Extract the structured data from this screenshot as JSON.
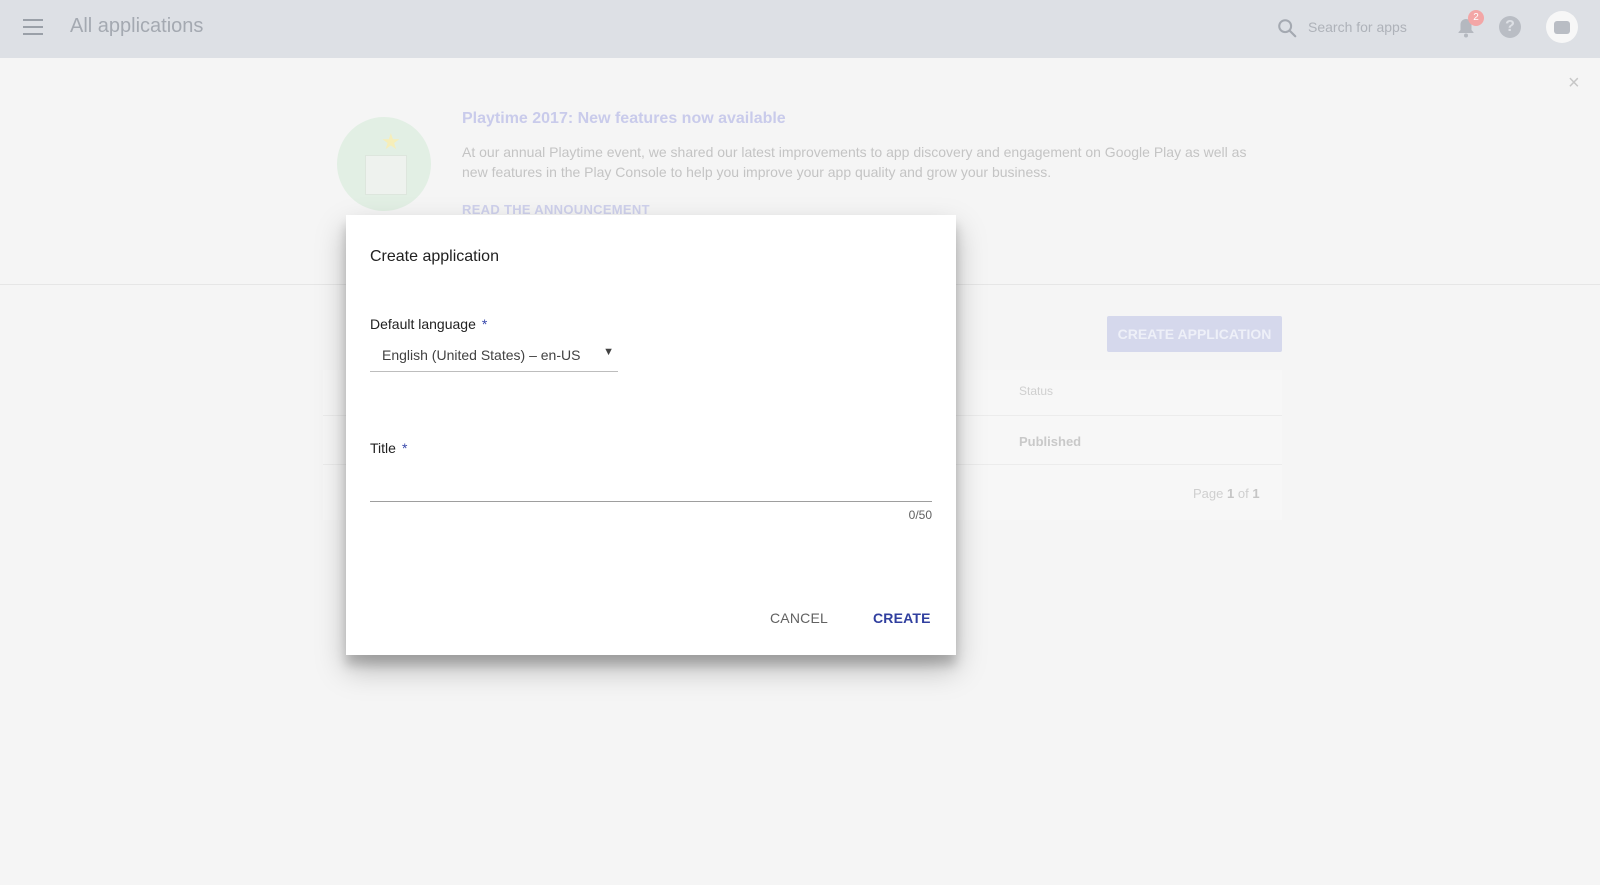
{
  "header": {
    "title": "All applications",
    "search_placeholder": "Search for apps",
    "notification_count": "2",
    "help_glyph": "?"
  },
  "announcement": {
    "title": "Playtime 2017: New features now available",
    "body": "At our annual Playtime event, we shared our latest improvements to app discovery and engagement on Google Play as well as new features in the Play Console to help you improve your app quality and grow your business.",
    "link": "READ THE ANNOUNCEMENT",
    "close_glyph": "×"
  },
  "apps": {
    "create_label": "CREATE APPLICATION",
    "status_header": "Status",
    "status_value": "Published",
    "pager": {
      "prefix": "Page",
      "current": "1",
      "sep": "of",
      "total": "1"
    }
  },
  "dialog": {
    "title": "Create application",
    "language_label": "Default language",
    "language_value": "English (United States) – en-US",
    "title_label": "Title",
    "required_mark": "*",
    "title_value": "",
    "counter": "0/50",
    "cancel_label": "CANCEL",
    "create_label": "CREATE"
  },
  "colors": {
    "accent": "#303f9f",
    "required": "#3949ab",
    "overlay_topbar": "#dde0e5"
  },
  "icons": {
    "menu": "menu-icon",
    "search": "search-icon",
    "bell": "bell-icon",
    "help": "help-icon",
    "avatar": "avatar",
    "dropdown": "dropdown-arrow-icon"
  }
}
